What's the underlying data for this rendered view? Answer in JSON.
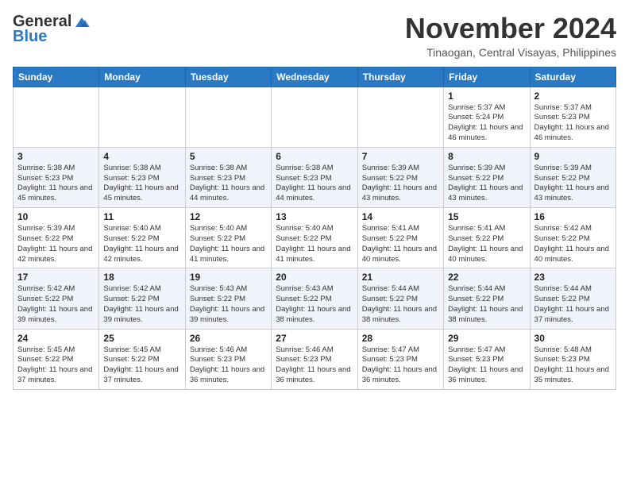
{
  "header": {
    "logo_general": "General",
    "logo_blue": "Blue",
    "month_title": "November 2024",
    "location": "Tinaogan, Central Visayas, Philippines"
  },
  "weekdays": [
    "Sunday",
    "Monday",
    "Tuesday",
    "Wednesday",
    "Thursday",
    "Friday",
    "Saturday"
  ],
  "weeks": [
    [
      {
        "day": "",
        "info": ""
      },
      {
        "day": "",
        "info": ""
      },
      {
        "day": "",
        "info": ""
      },
      {
        "day": "",
        "info": ""
      },
      {
        "day": "",
        "info": ""
      },
      {
        "day": "1",
        "info": "Sunrise: 5:37 AM\nSunset: 5:24 PM\nDaylight: 11 hours and 46 minutes."
      },
      {
        "day": "2",
        "info": "Sunrise: 5:37 AM\nSunset: 5:23 PM\nDaylight: 11 hours and 46 minutes."
      }
    ],
    [
      {
        "day": "3",
        "info": "Sunrise: 5:38 AM\nSunset: 5:23 PM\nDaylight: 11 hours and 45 minutes."
      },
      {
        "day": "4",
        "info": "Sunrise: 5:38 AM\nSunset: 5:23 PM\nDaylight: 11 hours and 45 minutes."
      },
      {
        "day": "5",
        "info": "Sunrise: 5:38 AM\nSunset: 5:23 PM\nDaylight: 11 hours and 44 minutes."
      },
      {
        "day": "6",
        "info": "Sunrise: 5:38 AM\nSunset: 5:23 PM\nDaylight: 11 hours and 44 minutes."
      },
      {
        "day": "7",
        "info": "Sunrise: 5:39 AM\nSunset: 5:22 PM\nDaylight: 11 hours and 43 minutes."
      },
      {
        "day": "8",
        "info": "Sunrise: 5:39 AM\nSunset: 5:22 PM\nDaylight: 11 hours and 43 minutes."
      },
      {
        "day": "9",
        "info": "Sunrise: 5:39 AM\nSunset: 5:22 PM\nDaylight: 11 hours and 43 minutes."
      }
    ],
    [
      {
        "day": "10",
        "info": "Sunrise: 5:39 AM\nSunset: 5:22 PM\nDaylight: 11 hours and 42 minutes."
      },
      {
        "day": "11",
        "info": "Sunrise: 5:40 AM\nSunset: 5:22 PM\nDaylight: 11 hours and 42 minutes."
      },
      {
        "day": "12",
        "info": "Sunrise: 5:40 AM\nSunset: 5:22 PM\nDaylight: 11 hours and 41 minutes."
      },
      {
        "day": "13",
        "info": "Sunrise: 5:40 AM\nSunset: 5:22 PM\nDaylight: 11 hours and 41 minutes."
      },
      {
        "day": "14",
        "info": "Sunrise: 5:41 AM\nSunset: 5:22 PM\nDaylight: 11 hours and 40 minutes."
      },
      {
        "day": "15",
        "info": "Sunrise: 5:41 AM\nSunset: 5:22 PM\nDaylight: 11 hours and 40 minutes."
      },
      {
        "day": "16",
        "info": "Sunrise: 5:42 AM\nSunset: 5:22 PM\nDaylight: 11 hours and 40 minutes."
      }
    ],
    [
      {
        "day": "17",
        "info": "Sunrise: 5:42 AM\nSunset: 5:22 PM\nDaylight: 11 hours and 39 minutes."
      },
      {
        "day": "18",
        "info": "Sunrise: 5:42 AM\nSunset: 5:22 PM\nDaylight: 11 hours and 39 minutes."
      },
      {
        "day": "19",
        "info": "Sunrise: 5:43 AM\nSunset: 5:22 PM\nDaylight: 11 hours and 39 minutes."
      },
      {
        "day": "20",
        "info": "Sunrise: 5:43 AM\nSunset: 5:22 PM\nDaylight: 11 hours and 38 minutes."
      },
      {
        "day": "21",
        "info": "Sunrise: 5:44 AM\nSunset: 5:22 PM\nDaylight: 11 hours and 38 minutes."
      },
      {
        "day": "22",
        "info": "Sunrise: 5:44 AM\nSunset: 5:22 PM\nDaylight: 11 hours and 38 minutes."
      },
      {
        "day": "23",
        "info": "Sunrise: 5:44 AM\nSunset: 5:22 PM\nDaylight: 11 hours and 37 minutes."
      }
    ],
    [
      {
        "day": "24",
        "info": "Sunrise: 5:45 AM\nSunset: 5:22 PM\nDaylight: 11 hours and 37 minutes."
      },
      {
        "day": "25",
        "info": "Sunrise: 5:45 AM\nSunset: 5:22 PM\nDaylight: 11 hours and 37 minutes."
      },
      {
        "day": "26",
        "info": "Sunrise: 5:46 AM\nSunset: 5:23 PM\nDaylight: 11 hours and 36 minutes."
      },
      {
        "day": "27",
        "info": "Sunrise: 5:46 AM\nSunset: 5:23 PM\nDaylight: 11 hours and 36 minutes."
      },
      {
        "day": "28",
        "info": "Sunrise: 5:47 AM\nSunset: 5:23 PM\nDaylight: 11 hours and 36 minutes."
      },
      {
        "day": "29",
        "info": "Sunrise: 5:47 AM\nSunset: 5:23 PM\nDaylight: 11 hours and 36 minutes."
      },
      {
        "day": "30",
        "info": "Sunrise: 5:48 AM\nSunset: 5:23 PM\nDaylight: 11 hours and 35 minutes."
      }
    ]
  ]
}
